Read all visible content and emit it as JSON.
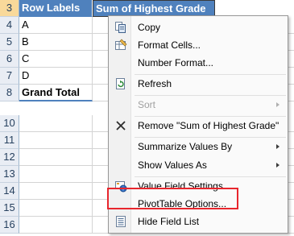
{
  "rows": [
    {
      "num": "3",
      "a": "Row Labels",
      "b": "Sum of Highest Grade"
    },
    {
      "num": "4",
      "a": "A",
      "b": ""
    },
    {
      "num": "5",
      "a": "B",
      "b": ""
    },
    {
      "num": "6",
      "a": "C",
      "b": ""
    },
    {
      "num": "7",
      "a": "D",
      "b": ""
    },
    {
      "num": "8",
      "a": "Grand Total",
      "b": ""
    },
    {
      "num": "10",
      "a": "",
      "b": ""
    },
    {
      "num": "11",
      "a": "",
      "b": ""
    },
    {
      "num": "12",
      "a": "",
      "b": ""
    },
    {
      "num": "13",
      "a": "",
      "b": ""
    },
    {
      "num": "14",
      "a": "",
      "b": ""
    },
    {
      "num": "15",
      "a": "",
      "b": ""
    },
    {
      "num": "16",
      "a": "",
      "b": ""
    }
  ],
  "menu": {
    "items": [
      {
        "label": "Copy",
        "icon": "copy-icon"
      },
      {
        "label": "Format Cells...",
        "icon": "format-cells-icon"
      },
      {
        "label": "Number Format...",
        "icon": ""
      },
      {
        "label": "Refresh",
        "icon": "refresh-icon"
      },
      {
        "label": "Sort",
        "icon": "",
        "disabled": true,
        "submenu": true
      },
      {
        "label": "Remove \"Sum of Highest Grade\"",
        "icon": "close-icon"
      },
      {
        "label": "Summarize Values By",
        "icon": "",
        "submenu": true
      },
      {
        "label": "Show Values As",
        "icon": "",
        "submenu": true
      },
      {
        "label": "Value Field Settings...",
        "icon": "value-field-settings-icon"
      },
      {
        "label": "PivotTable Options...",
        "icon": ""
      },
      {
        "label": "Hide Field List",
        "icon": "field-list-icon"
      }
    ]
  },
  "colors": {
    "pivot_header": "#4f81bd",
    "highlight_box": "#e8262d"
  }
}
